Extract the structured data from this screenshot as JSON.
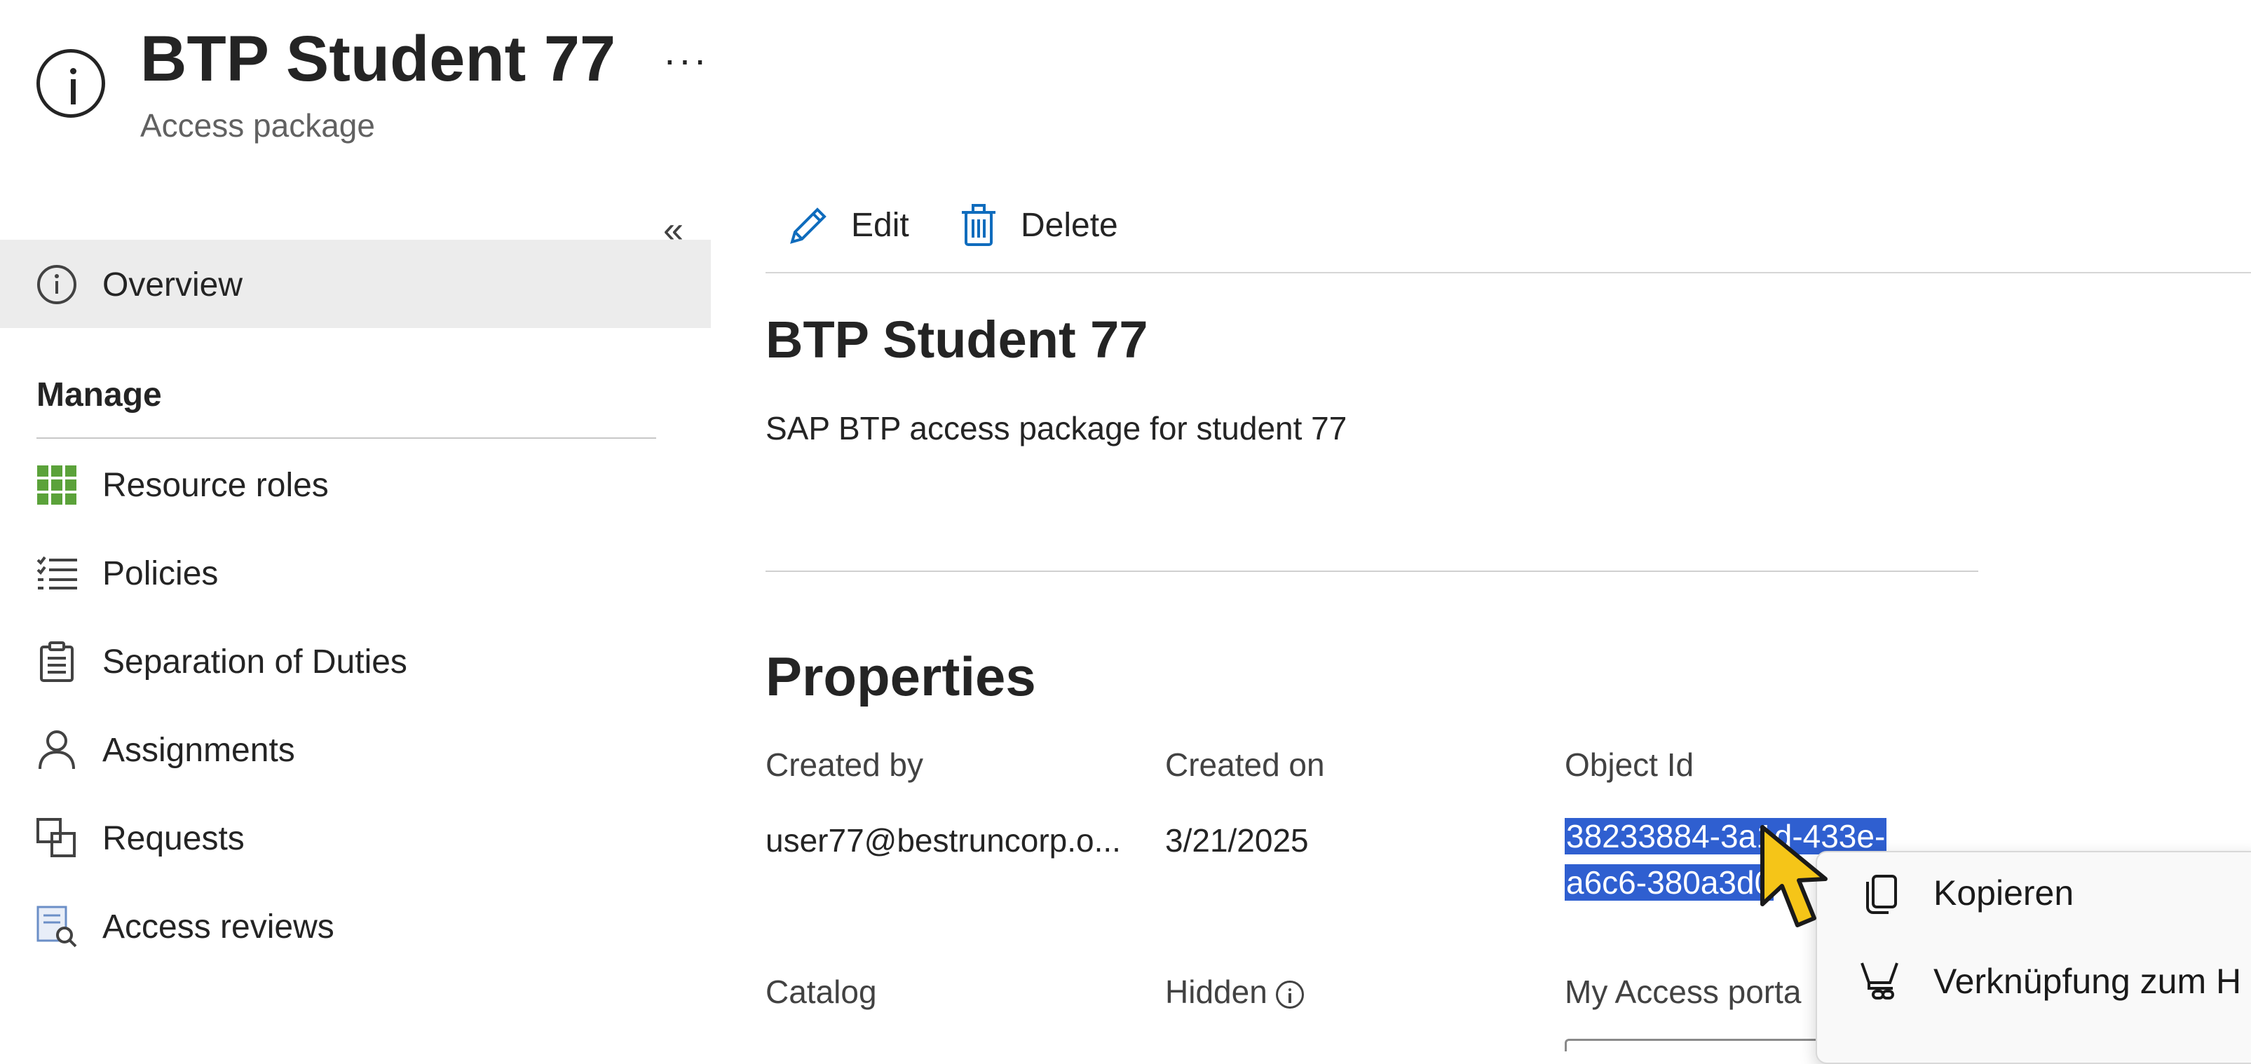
{
  "header": {
    "title": "BTP Student 77",
    "subtitle": "Access package",
    "more_label": "···"
  },
  "sidebar": {
    "collapse_label": "«",
    "overview_label": "Overview",
    "manage_heading": "Manage",
    "items": [
      {
        "label": "Resource roles",
        "icon": "grid-icon"
      },
      {
        "label": "Policies",
        "icon": "checklist-icon"
      },
      {
        "label": "Separation of Duties",
        "icon": "clipboard-icon"
      },
      {
        "label": "Assignments",
        "icon": "person-icon"
      },
      {
        "label": "Requests",
        "icon": "requests-icon"
      },
      {
        "label": "Access reviews",
        "icon": "review-icon"
      }
    ]
  },
  "toolbar": {
    "edit_label": "Edit",
    "delete_label": "Delete"
  },
  "main": {
    "title": "BTP Student 77",
    "description": "SAP BTP access package for student 77",
    "properties_heading": "Properties",
    "created_by_label": "Created by",
    "created_by_value": "user77@bestruncorp.o...",
    "created_on_label": "Created on",
    "created_on_value": "3/21/2025",
    "object_id_label": "Object Id",
    "object_id_line1": "38233884-3a1d-433e-",
    "object_id_line2": "a6c6-380a3d0",
    "catalog_label": "Catalog",
    "hidden_label": "Hidden",
    "my_access_portal_label": "My Access porta"
  },
  "context_menu": {
    "copy_label": "Kopieren",
    "link_label": "Verknüpfung zum H"
  },
  "colors": {
    "selection": "#2f5fd0",
    "accent_blue": "#0f6cbd",
    "grid_green": "#5ba23a",
    "cursor_yellow": "#f5c518"
  }
}
